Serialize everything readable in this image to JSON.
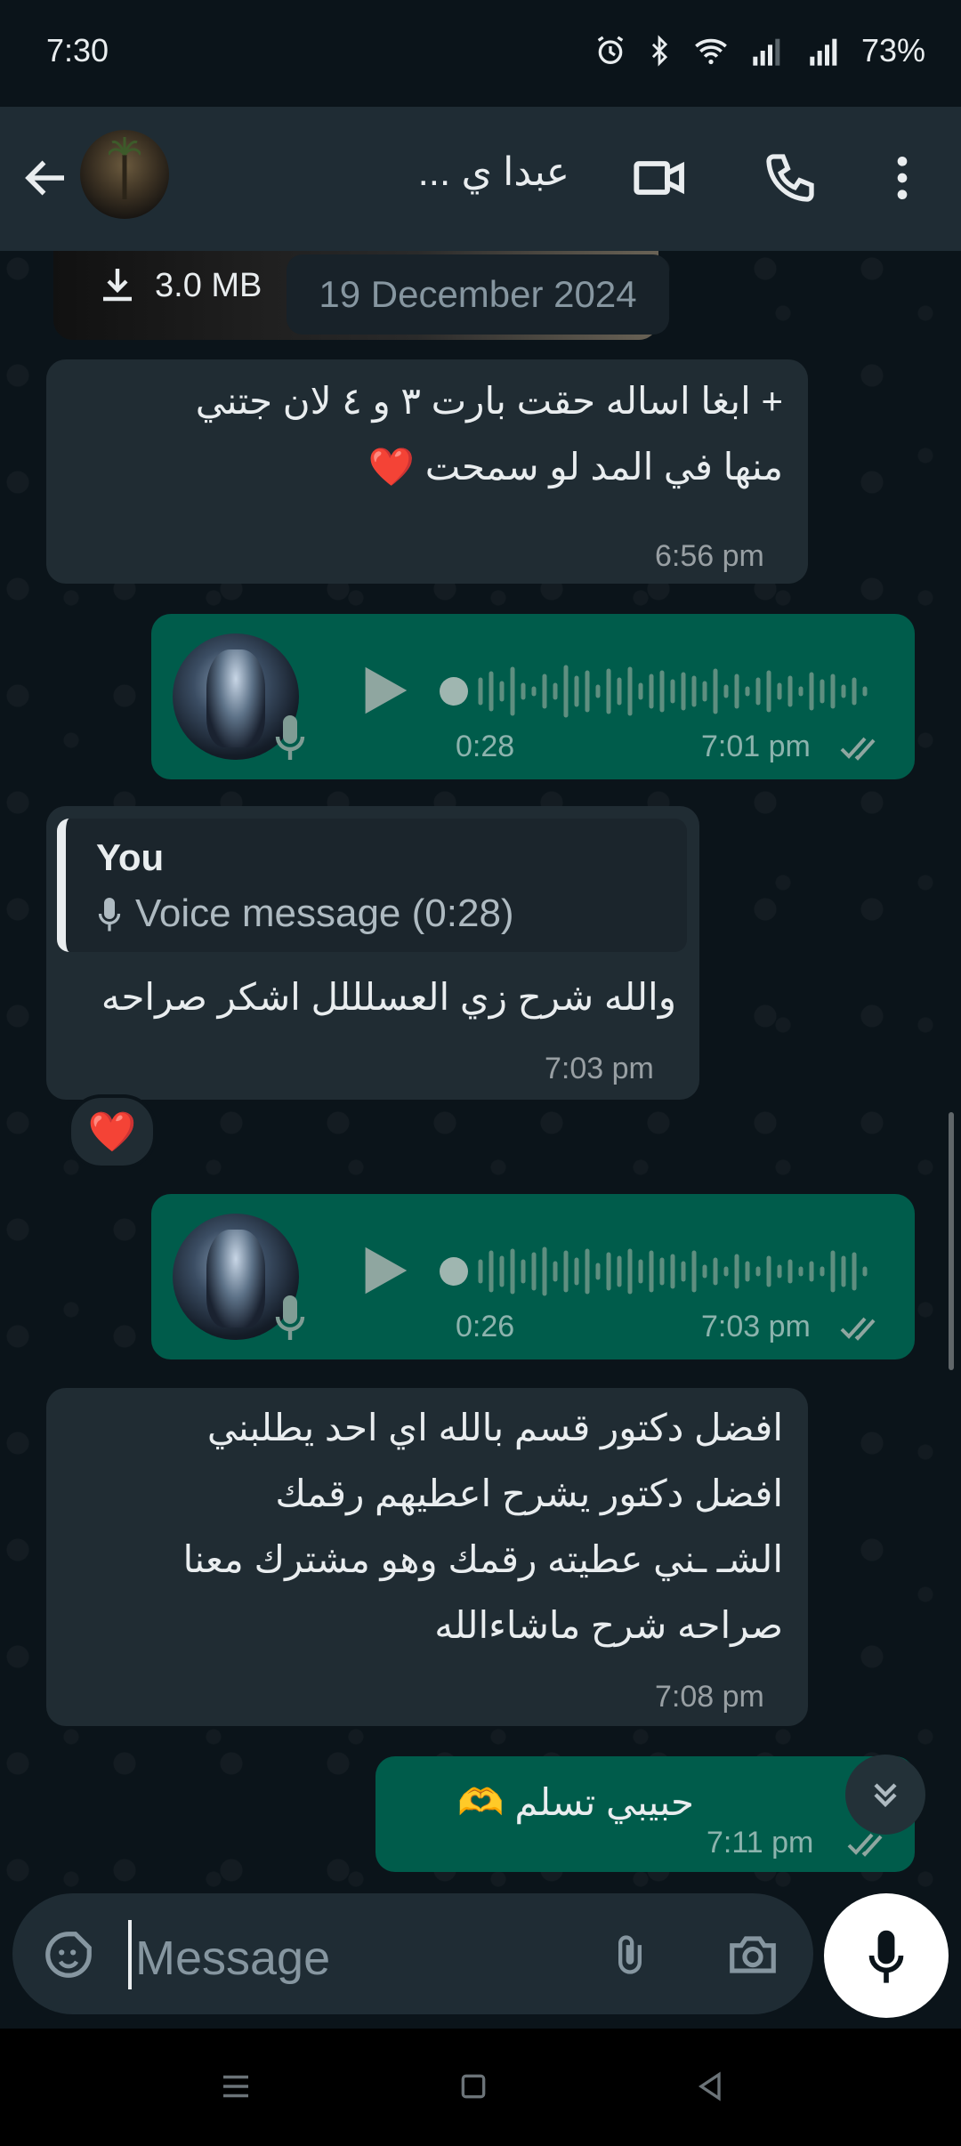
{
  "status_bar": {
    "time": "7:30",
    "battery": "73%"
  },
  "header": {
    "contact_name": "عبدا        ي ..."
  },
  "attachment": {
    "file_size": "3.0 MB"
  },
  "date_separator": "19 December 2024",
  "messages": [
    {
      "type": "text",
      "direction": "in",
      "text": "+ ابغا اساله حقت بارت ٣ و ٤ لان جتني\nمنها في المد لو سمحت ❤️",
      "time": "6:56 pm"
    },
    {
      "type": "voice",
      "direction": "out",
      "duration": "0:28",
      "time": "7:01 pm"
    },
    {
      "type": "text",
      "direction": "in",
      "quote_author": "You",
      "quote_text": "Voice message (0:28)",
      "text": "والله شرح زي العسلللل اشكر صراحه",
      "time": "7:03 pm",
      "reaction": "❤️"
    },
    {
      "type": "voice",
      "direction": "out",
      "duration": "0:26",
      "time": "7:03 pm"
    },
    {
      "type": "text",
      "direction": "in",
      "text": "افضل دكتور قسم بالله اي احد يطلبني\nافضل دكتور يشرح اعطيهم رقمك     \nالشـ   ـني عطيته رقمك وهو مشترك معنا\nصراحه شرح ماشاءالله",
      "time": "7:08 pm"
    },
    {
      "type": "text",
      "direction": "out",
      "text": "حبيبي تسلم 🫶",
      "time": "7:11 pm"
    }
  ],
  "input": {
    "placeholder": "Message"
  },
  "icons": {
    "back": "arrow-left-icon",
    "video": "video-call-icon",
    "call": "phone-icon",
    "menu": "more-vert-icon",
    "emoji": "sticker-icon",
    "attach": "paperclip-icon",
    "camera": "camera-icon",
    "mic": "mic-icon"
  },
  "colors": {
    "incoming_bubble": "#202c33",
    "outgoing_bubble": "#005c4b",
    "header": "#1f2c34",
    "background": "#0b141a",
    "read_ticks": "#8696a0"
  }
}
